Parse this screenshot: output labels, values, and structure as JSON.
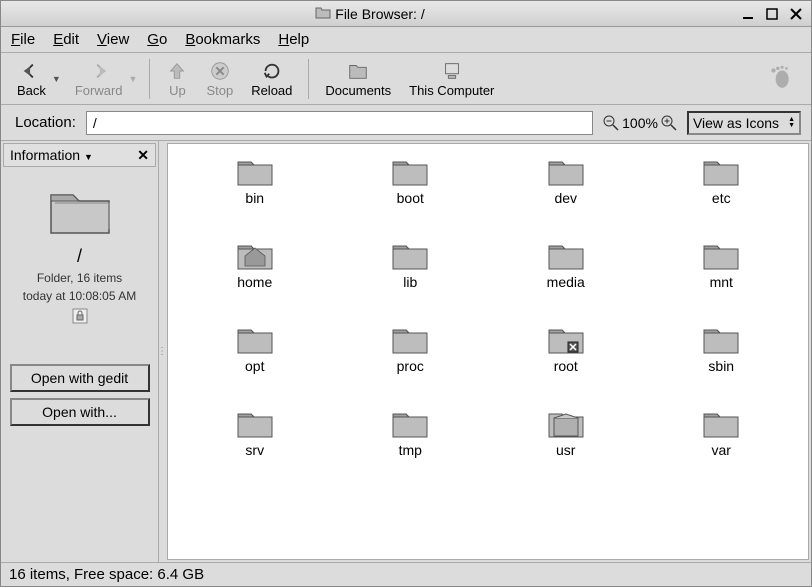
{
  "window": {
    "title": "File Browser: /"
  },
  "menu": {
    "file": "File",
    "edit": "Edit",
    "view": "View",
    "go": "Go",
    "bookmarks": "Bookmarks",
    "help": "Help"
  },
  "toolbar": {
    "back": "Back",
    "forward": "Forward",
    "up": "Up",
    "stop": "Stop",
    "reload": "Reload",
    "documents": "Documents",
    "computer": "This Computer"
  },
  "location": {
    "label": "Location:",
    "value": "/",
    "zoom": "100%",
    "viewas": "View as Icons"
  },
  "sidebar": {
    "head": "Information",
    "name": "/",
    "info1": "Folder, 16 items",
    "info2": "today at 10:08:05 AM",
    "open_gedit": "Open with gedit",
    "open_with": "Open with..."
  },
  "folders": [
    "bin",
    "boot",
    "dev",
    "etc",
    "home",
    "lib",
    "media",
    "mnt",
    "opt",
    "proc",
    "root",
    "sbin",
    "srv",
    "tmp",
    "usr",
    "var"
  ],
  "special": {
    "home": true,
    "root": true,
    "usr": true
  },
  "status": "16 items, Free space: 6.4 GB"
}
